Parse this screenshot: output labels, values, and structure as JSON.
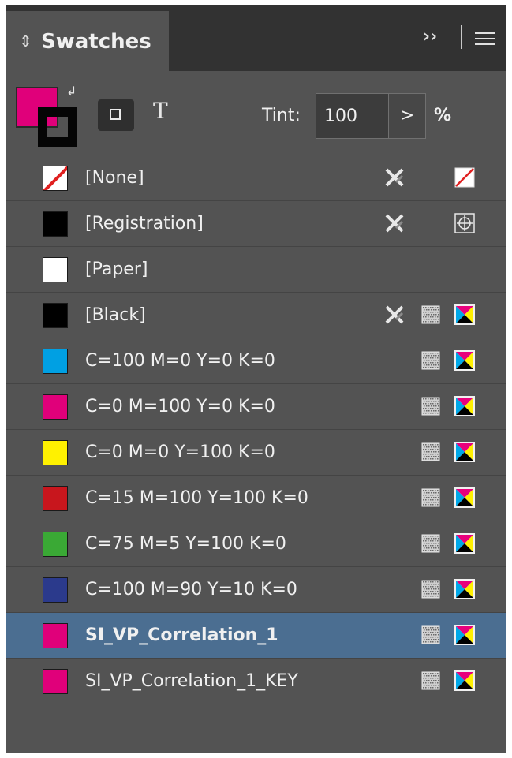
{
  "panel": {
    "title": "Swatches",
    "collapse_glyph": "››",
    "menu_icon": "hamburger-menu-icon"
  },
  "controls": {
    "fill_color": "#e0007a",
    "stroke_color": "#050505",
    "tint_label": "Tint:",
    "tint_value": "100",
    "tint_arrow": ">",
    "tint_unit": "%",
    "text_glyph": "T"
  },
  "swatches": [
    {
      "label": "[None]",
      "chip": "none",
      "nonedit": true,
      "mode": "none",
      "type": "none-icon"
    },
    {
      "label": "[Registration]",
      "chip": "#000000",
      "nonedit": true,
      "mode": "none",
      "type": "registration-icon"
    },
    {
      "label": "[Paper]",
      "chip": "#ffffff",
      "nonedit": false,
      "mode": "none",
      "type": "none"
    },
    {
      "label": "[Black]",
      "chip": "#000000",
      "nonedit": true,
      "mode": "process",
      "type": "cmyk-icon"
    },
    {
      "label": "C=100 M=0 Y=0 K=0",
      "chip": "#00a0e3",
      "nonedit": false,
      "mode": "process",
      "type": "cmyk-icon"
    },
    {
      "label": "C=0 M=100 Y=0 K=0",
      "chip": "#e0007a",
      "nonedit": false,
      "mode": "process",
      "type": "cmyk-icon"
    },
    {
      "label": "C=0 M=0 Y=100 K=0",
      "chip": "#fff100",
      "nonedit": false,
      "mode": "process",
      "type": "cmyk-icon"
    },
    {
      "label": "C=15 M=100 Y=100 K=0",
      "chip": "#c8161d",
      "nonedit": false,
      "mode": "process",
      "type": "cmyk-icon"
    },
    {
      "label": "C=75 M=5 Y=100 K=0",
      "chip": "#3aa935",
      "nonedit": false,
      "mode": "process",
      "type": "cmyk-icon"
    },
    {
      "label": "C=100 M=90 Y=10 K=0",
      "chip": "#2b3a8c",
      "nonedit": false,
      "mode": "process",
      "type": "cmyk-icon"
    },
    {
      "label": "SI_VP_Correlation_1",
      "chip": "#e0007a",
      "nonedit": false,
      "mode": "process",
      "type": "cmyk-icon",
      "selected": true,
      "bold": true
    },
    {
      "label": "SI_VP_Correlation_1_KEY",
      "chip": "#e0007a",
      "nonedit": false,
      "mode": "process",
      "type": "cmyk-icon"
    }
  ],
  "colors": {
    "panel_bg": "#535353",
    "header_bg": "#323232",
    "selection": "#4b6e91"
  }
}
